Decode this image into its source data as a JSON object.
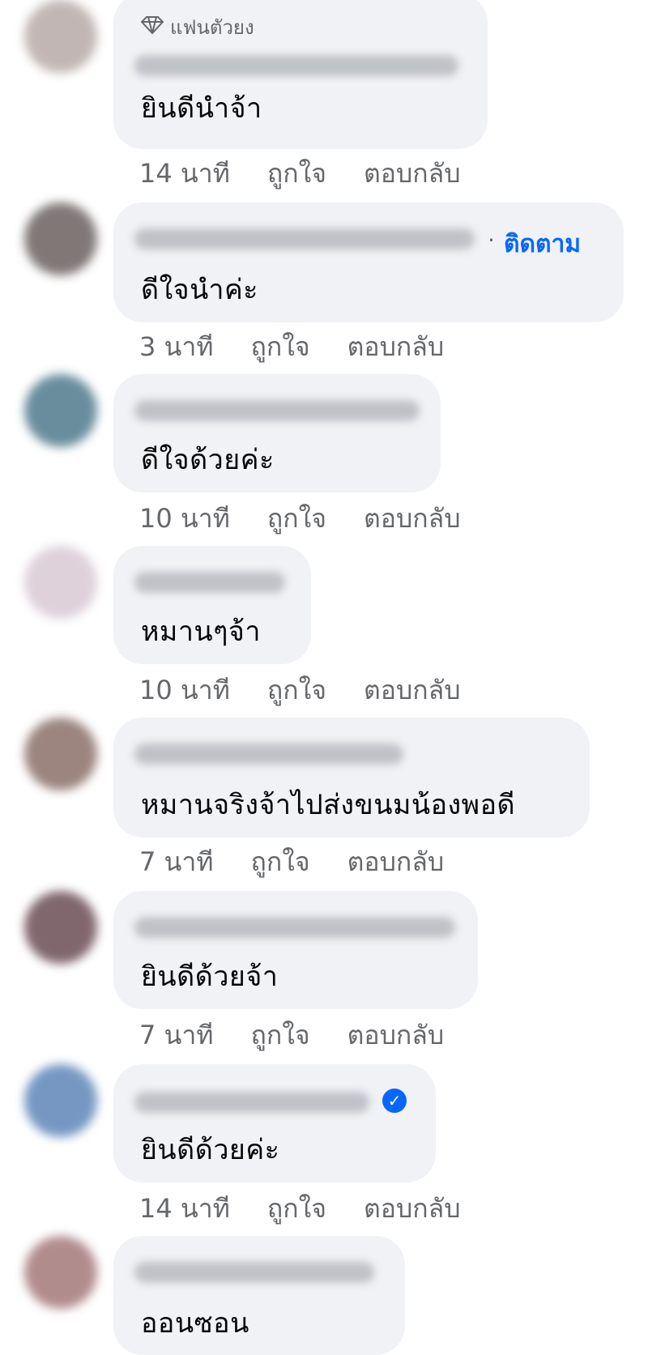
{
  "labels": {
    "like": "ถูกใจ",
    "reply": "ตอบกลับ",
    "follow": "ติดตาม",
    "top_fan_badge": "แฟนตัวยง"
  },
  "comments": [
    {
      "text": "ยินดีนำจ้า",
      "time": "14 นาที",
      "avatar_color": "#b7aaa6",
      "has_badge": true
    },
    {
      "text": "ดีใจนำค่ะ",
      "time": "3 นาที",
      "avatar_color": "#6b6160",
      "has_follow": true
    },
    {
      "text": "ดีใจด้วยค่ะ",
      "time": "10 นาที",
      "avatar_color": "#4f7a8c"
    },
    {
      "text": "หมานๆจ้า",
      "time": "10 นาที",
      "avatar_color": "#d9c9d4"
    },
    {
      "text": "หมานจริงจ้าไปส่งขนมน้องพอดี",
      "time": "7 นาที",
      "avatar_color": "#8a7068",
      "name_visible_partial": true
    },
    {
      "text": "ยินดีด้วยจ้า",
      "time": "7 นาที",
      "avatar_color": "#6a4d55"
    },
    {
      "text": "ยินดีด้วยค่ะ",
      "time": "14 นาที",
      "avatar_color": "#5d86b8",
      "verified": true
    },
    {
      "text": "ออนซอน",
      "time": "",
      "avatar_color": "#a4787a"
    }
  ],
  "colors": {
    "bubble_bg": "#f0f2f5",
    "text": "#050505",
    "meta": "#65676b",
    "link_blue": "#0866ff"
  }
}
